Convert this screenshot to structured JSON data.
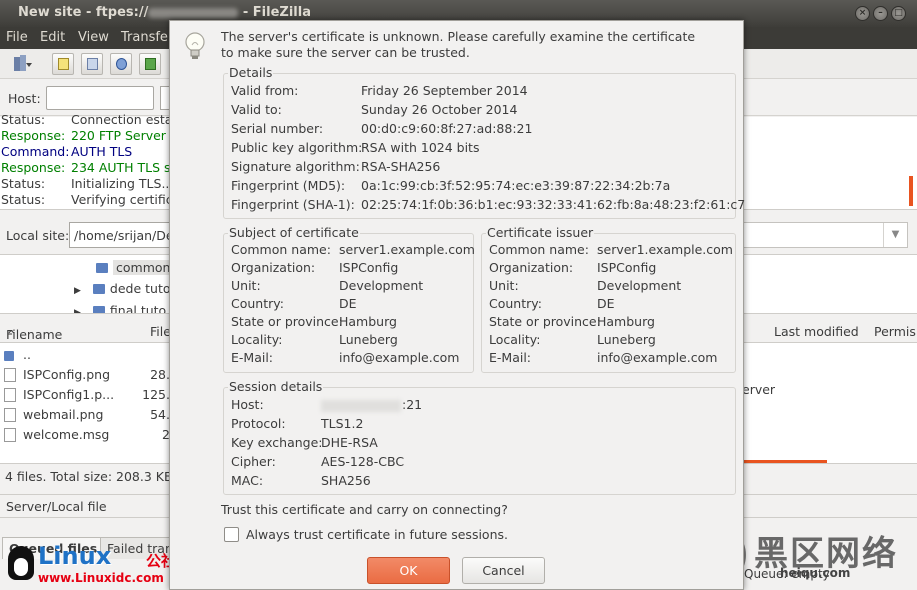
{
  "window": {
    "title_prefix": "New site - ftpes://",
    "title_suffix": "- FileZilla"
  },
  "menu": [
    "File",
    "Edit",
    "View",
    "Transfer"
  ],
  "quickconnect": {
    "host_label": "Host:"
  },
  "log": [
    {
      "kind": "Status:",
      "text": "Connection esta",
      "color": "#3c3c3c"
    },
    {
      "kind": "Response:",
      "text": "220 FTP Server r",
      "color": "#008000"
    },
    {
      "kind": "Command:",
      "text": "AUTH TLS",
      "color": "#000080"
    },
    {
      "kind": "Response:",
      "text": "234 AUTH TLS su",
      "color": "#008000"
    },
    {
      "kind": "Status:",
      "text": "Initializing TLS...",
      "color": "#3c3c3c"
    },
    {
      "kind": "Status:",
      "text": "Verifying certific",
      "color": "#3c3c3c"
    }
  ],
  "local_site": {
    "label": "Local site:",
    "path": "/home/srijan/De"
  },
  "tree": [
    "common_",
    "dede tuto",
    "final tuto"
  ],
  "list_headers": {
    "filename": "Filename",
    "filesize": "File",
    "last_modified": "Last modified",
    "permissions": "Permis"
  },
  "files": [
    {
      "name": "..",
      "size": ""
    },
    {
      "name": "ISPConfig.png",
      "size": "28."
    },
    {
      "name": "ISPConfig1.p...",
      "size": "125."
    },
    {
      "name": "webmail.png",
      "size": "54."
    },
    {
      "name": "welcome.msg",
      "size": "2"
    }
  ],
  "remote_fragment": "erver",
  "local_status": "4 files. Total size: 208.3 KB",
  "queue_header": "Server/Local file",
  "tabs": [
    "Queued files",
    "Failed tran"
  ],
  "queue_status": "Queue: empty",
  "watermark_left": {
    "brand": "Linux",
    "brand_cn": "公社",
    "url": "www.Linuxidc.com"
  },
  "watermark_right": {
    "big": "黑区网络",
    "small": "heiqu.com"
  },
  "dialog": {
    "message": "The server's certificate is unknown. Please carefully examine the certificate to make sure the server can be trusted.",
    "details": {
      "title": "Details",
      "rows": [
        {
          "k": "Valid from:",
          "v": "Friday 26 September 2014"
        },
        {
          "k": "Valid to:",
          "v": "Sunday 26 October 2014"
        },
        {
          "k": "Serial number:",
          "v": "00:d0:c9:60:8f:27:ad:88:21"
        },
        {
          "k": "Public key algorithm:",
          "v": "RSA with 1024 bits"
        },
        {
          "k": "Signature algorithm:",
          "v": "RSA-SHA256"
        },
        {
          "k": "Fingerprint (MD5):",
          "v": "0a:1c:99:cb:3f:52:95:74:ec:e3:39:87:22:34:2b:7a"
        },
        {
          "k": "Fingerprint (SHA-1):",
          "v": "02:25:74:1f:0b:36:b1:ec:93:32:33:41:62:fb:8a:48:23:f2:61:c7"
        }
      ]
    },
    "subject": {
      "title": "Subject of certificate",
      "rows": [
        {
          "k": "Common name:",
          "v": "server1.example.com"
        },
        {
          "k": "Organization:",
          "v": "ISPConfig"
        },
        {
          "k": "Unit:",
          "v": "Development"
        },
        {
          "k": "Country:",
          "v": "DE"
        },
        {
          "k": "State or province:",
          "v": "Hamburg"
        },
        {
          "k": "Locality:",
          "v": "Luneberg"
        },
        {
          "k": "E-Mail:",
          "v": "info@example.com"
        }
      ]
    },
    "issuer": {
      "title": "Certificate issuer",
      "rows": [
        {
          "k": "Common name:",
          "v": "server1.example.com"
        },
        {
          "k": "Organization:",
          "v": "ISPConfig"
        },
        {
          "k": "Unit:",
          "v": "Development"
        },
        {
          "k": "Country:",
          "v": "DE"
        },
        {
          "k": "State or province:",
          "v": "Hamburg"
        },
        {
          "k": "Locality:",
          "v": "Luneberg"
        },
        {
          "k": "E-Mail:",
          "v": "info@example.com"
        }
      ]
    },
    "session": {
      "title": "Session details",
      "rows": [
        {
          "k": "Host:",
          "v": ":21"
        },
        {
          "k": "Protocol:",
          "v": "TLS1.2"
        },
        {
          "k": "Key exchange:",
          "v": "DHE-RSA"
        },
        {
          "k": "Cipher:",
          "v": "AES-128-CBC"
        },
        {
          "k": "MAC:",
          "v": "SHA256"
        }
      ]
    },
    "question": "Trust this certificate and carry on connecting?",
    "always_trust_label": "Always trust certificate in future sessions.",
    "always_trust_checked": false,
    "ok_label": "OK",
    "cancel_label": "Cancel"
  }
}
